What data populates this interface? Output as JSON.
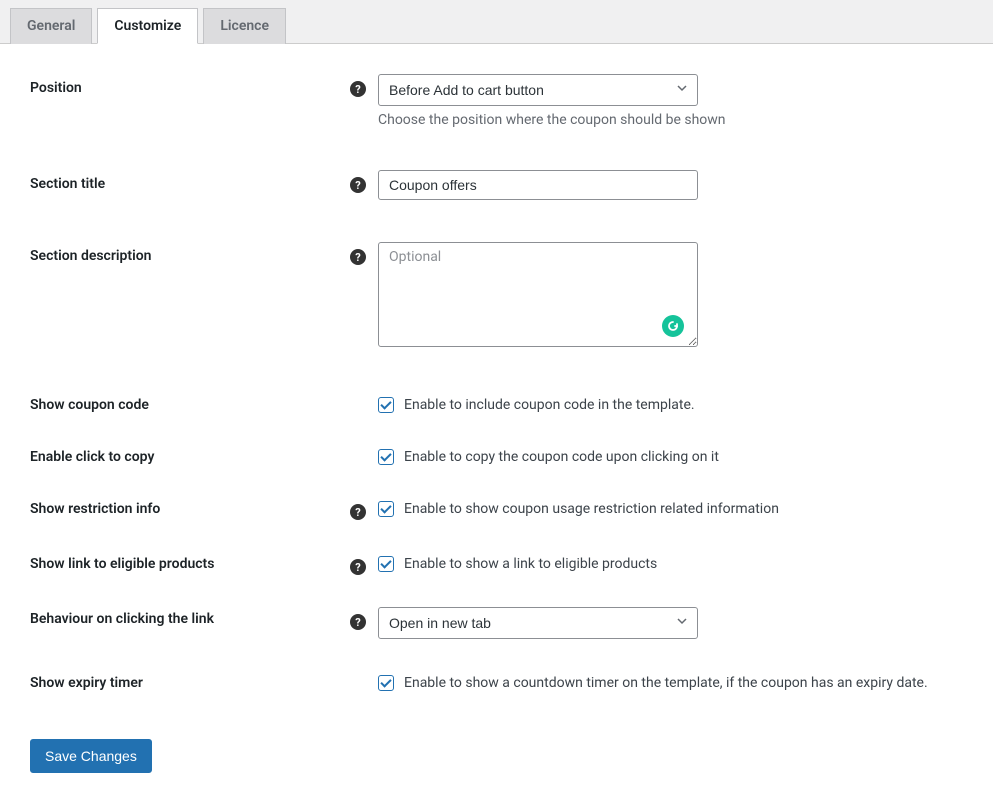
{
  "tabs": {
    "general": "General",
    "customize": "Customize",
    "licence": "Licence"
  },
  "fields": {
    "position": {
      "label": "Position",
      "value": "Before Add to cart button",
      "description": "Choose the position where the coupon should be shown"
    },
    "section_title": {
      "label": "Section title",
      "value": "Coupon offers"
    },
    "section_description": {
      "label": "Section description",
      "placeholder": "Optional",
      "value": ""
    },
    "show_coupon_code": {
      "label": "Show coupon code",
      "cb_label": "Enable to include coupon code in the template."
    },
    "enable_click_to_copy": {
      "label": "Enable click to copy",
      "cb_label": "Enable to copy the coupon code upon clicking on it"
    },
    "show_restriction_info": {
      "label": "Show restriction info",
      "cb_label": "Enable to show coupon usage restriction related information"
    },
    "show_link_eligible": {
      "label": "Show link to eligible products",
      "cb_label": "Enable to show a link to eligible products"
    },
    "behaviour_link": {
      "label": "Behaviour on clicking the link",
      "value": "Open in new tab"
    },
    "show_expiry_timer": {
      "label": "Show expiry timer",
      "cb_label": "Enable to show a countdown timer on the template, if the coupon has an expiry date."
    }
  },
  "buttons": {
    "save": "Save Changes"
  }
}
